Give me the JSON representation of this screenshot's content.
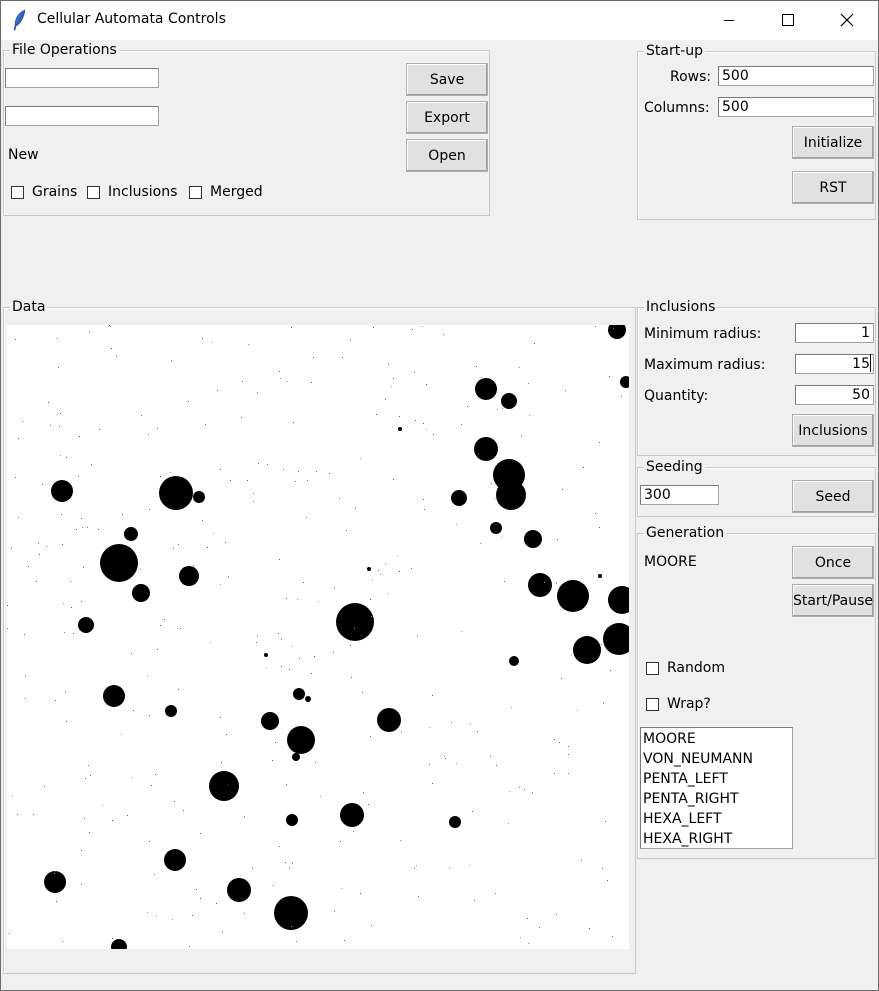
{
  "window": {
    "title": "Cellular Automata Controls",
    "icons": {
      "app": "feather-icon",
      "minimize": "minimize-icon",
      "maximize": "maximize-icon",
      "close": "close-icon"
    }
  },
  "file_ops": {
    "legend": "File Operations",
    "input1": "",
    "input2": "",
    "status": "New",
    "save": "Save",
    "export": "Export",
    "open": "Open",
    "checks": [
      "Grains",
      "Inclusions",
      "Merged"
    ]
  },
  "startup": {
    "legend": "Start-up",
    "rows_label": "Rows:",
    "rows_value": "500",
    "cols_label": "Columns:",
    "cols_value": "500",
    "initialize": "Initialize",
    "rst": "RST"
  },
  "data_panel": {
    "legend": "Data"
  },
  "inclusions": {
    "legend": "Inclusions",
    "min_label": "Minimum radius:",
    "min_value": "1",
    "max_label": "Maximum radius:",
    "max_value": "15",
    "qty_label": "Quantity:",
    "qty_value": "50",
    "button": "Inclusions"
  },
  "seeding": {
    "legend": "Seeding",
    "value": "300",
    "button": "Seed"
  },
  "generation": {
    "legend": "Generation",
    "current": "MOORE",
    "once": "Once",
    "start_pause": "Start/Pause",
    "random": "Random",
    "wrap": "Wrap?",
    "options": [
      "MOORE",
      "VON_NEUMANN",
      "PENTA_LEFT",
      "PENTA_RIGHT",
      "HEXA_LEFT",
      "HEXA_RIGHT"
    ]
  },
  "colors": {
    "background": "#f0f0f0",
    "grain": "#000000",
    "canvas": "#ffffff"
  }
}
